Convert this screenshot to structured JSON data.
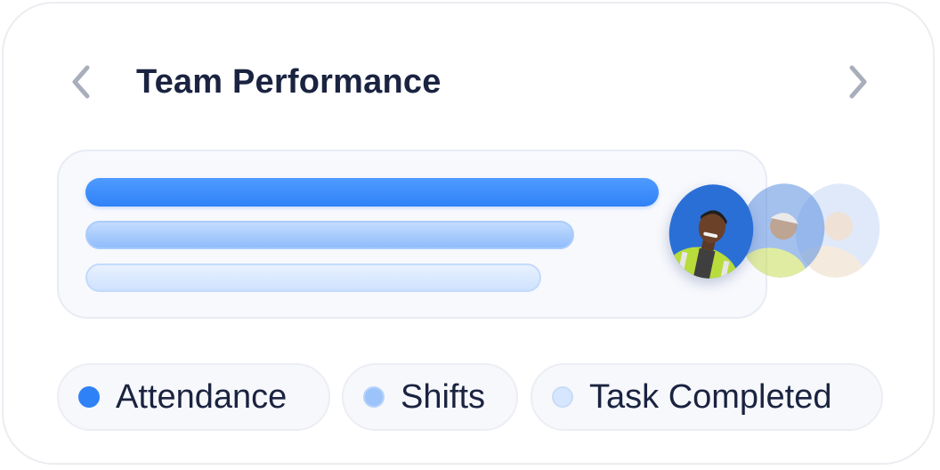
{
  "header": {
    "title": "Team Performance",
    "prev_icon": "chevron-left-icon",
    "next_icon": "chevron-right-icon"
  },
  "metrics": [
    {
      "name": "Attendance",
      "level_fraction": 0.88,
      "color": "#2f81f7"
    },
    {
      "name": "Shifts",
      "level_fraction": 0.75,
      "color": "#9cc4fb"
    },
    {
      "name": "Task Completed",
      "level_fraction": 0.7,
      "color": "#d6e6fe"
    }
  ],
  "legend": {
    "items": [
      {
        "label": "Attendance",
        "dot_color": "#2f81f7"
      },
      {
        "label": "Shifts",
        "dot_color": "#9cc4fb"
      },
      {
        "label": "Task Completed",
        "dot_color": "#d6e6fe"
      }
    ]
  },
  "team": {
    "avatar_count": 3
  }
}
